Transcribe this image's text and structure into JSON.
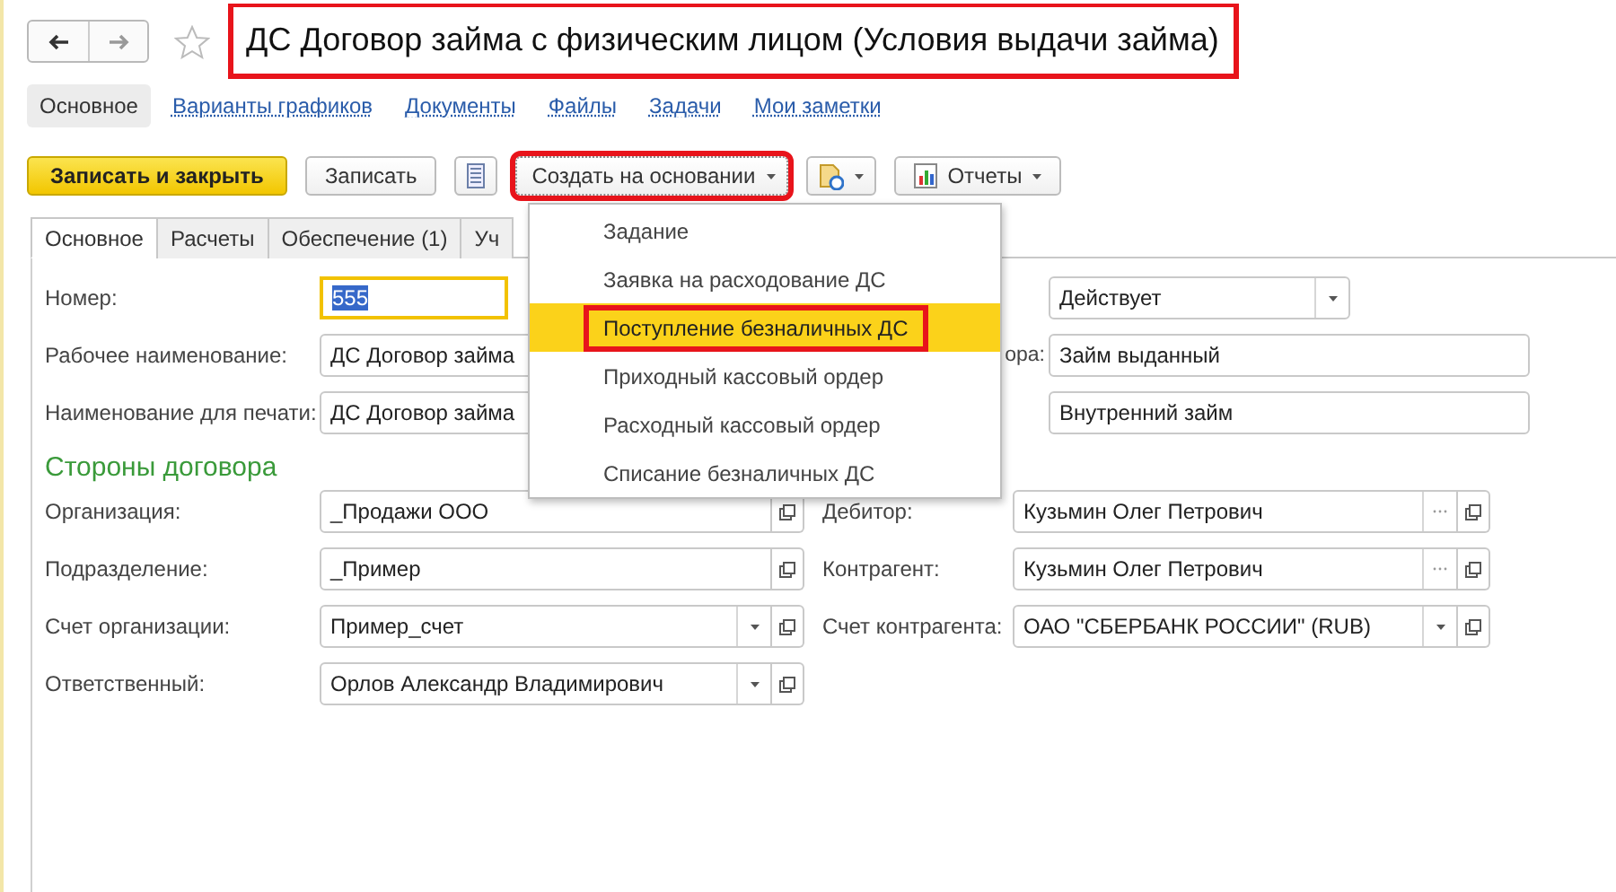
{
  "title": {
    "text": "ДС Договор займа с физическим лицом (Условия выдачи займа)",
    "highlighted": true
  },
  "sections": [
    {
      "label": "Основное",
      "selected": true
    },
    {
      "label": "Варианты графиков",
      "selected": false
    },
    {
      "label": "Документы",
      "selected": false
    },
    {
      "label": "Файлы",
      "selected": false
    },
    {
      "label": "Задачи",
      "selected": false
    },
    {
      "label": "Мои заметки",
      "selected": false
    }
  ],
  "toolbar": [
    {
      "kind": "primary",
      "label": "Записать и закрыть",
      "highlighted": false
    },
    {
      "kind": "plain",
      "label": "Записать",
      "highlighted": false
    },
    {
      "kind": "list",
      "highlighted": false
    },
    {
      "kind": "dropdown",
      "label": "Создать на основании",
      "highlighted": true
    },
    {
      "kind": "doc-dropdown",
      "highlighted": false
    },
    {
      "kind": "report-dropdown",
      "label": "Отчеты",
      "highlighted": false
    }
  ],
  "tabs": [
    {
      "label": "Основное",
      "selected": true
    },
    {
      "label": "Расчеты",
      "selected": false
    },
    {
      "label": "Обеспечение (1)",
      "selected": false
    },
    {
      "label": "Уч",
      "selected": false
    }
  ],
  "main_rows": [
    {
      "label": "Номер:",
      "value": "555",
      "focused": true,
      "right": {
        "kind": "select",
        "value": "Действует"
      }
    },
    {
      "label": "Рабочее наименование:",
      "value": "ДС Договор займа",
      "focused": false,
      "right": {
        "kind": "text",
        "label": "ора:",
        "value": "Займ выданный"
      }
    },
    {
      "label": "Наименование для печати:",
      "value": "ДС Договор займа",
      "focused": false,
      "right": {
        "kind": "text",
        "value": "Внутренний займ"
      }
    }
  ],
  "section_title": "Стороны договора",
  "party_rows": [
    {
      "label": "Организация:",
      "value": "_Продажи ООО",
      "kind": "open",
      "right": {
        "label": "Дебитор:",
        "value": "Кузьмин Олег Петрович",
        "kind": "choice-open"
      }
    },
    {
      "label": "Подразделение:",
      "value": "_Пример",
      "kind": "open",
      "right": {
        "label": "Контрагент:",
        "value": "Кузьмин Олег Петрович",
        "kind": "choice-open"
      }
    },
    {
      "label": "Счет организации:",
      "value": "Пример_счет",
      "kind": "select-open",
      "right": {
        "label": "Счет контрагента:",
        "value": "ОАО \"СБЕРБАНК РОССИИ\" (RUB)",
        "kind": "select-open"
      }
    },
    {
      "label": "Ответственный:",
      "value": "Орлов Александр Владимирович",
      "kind": "select-open"
    }
  ],
  "menu": {
    "items": [
      {
        "label": "Задание",
        "selected": false,
        "highlighted": false
      },
      {
        "label": "Заявка на расходование ДС",
        "selected": false,
        "highlighted": false
      },
      {
        "label": "Поступление безналичных ДС",
        "selected": true,
        "highlighted": true
      },
      {
        "label": "Приходный кассовый ордер",
        "selected": false,
        "highlighted": false
      },
      {
        "label": "Расходный кассовый ордер",
        "selected": false,
        "highlighted": false
      },
      {
        "label": "Списание безналичных ДС",
        "selected": false,
        "highlighted": false
      }
    ]
  }
}
